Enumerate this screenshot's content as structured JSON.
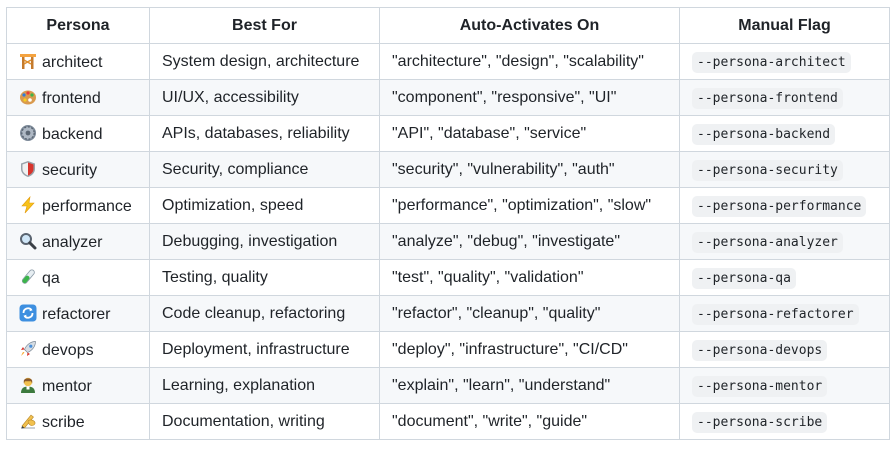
{
  "headers": [
    "Persona",
    "Best For",
    "Auto-Activates On",
    "Manual Flag"
  ],
  "rows": [
    {
      "icon": "building-construction-icon",
      "persona": "architect",
      "best_for": "System design, architecture",
      "triggers": "\"architecture\", \"design\", \"scalability\"",
      "flag": "--persona-architect"
    },
    {
      "icon": "artist-palette-icon",
      "persona": "frontend",
      "best_for": "UI/UX, accessibility",
      "triggers": "\"component\", \"responsive\", \"UI\"",
      "flag": "--persona-frontend"
    },
    {
      "icon": "gear-icon",
      "persona": "backend",
      "best_for": "APIs, databases, reliability",
      "triggers": "\"API\", \"database\", \"service\"",
      "flag": "--persona-backend"
    },
    {
      "icon": "shield-icon",
      "persona": "security",
      "best_for": "Security, compliance",
      "triggers": "\"security\", \"vulnerability\", \"auth\"",
      "flag": "--persona-security"
    },
    {
      "icon": "lightning-icon",
      "persona": "performance",
      "best_for": "Optimization, speed",
      "triggers": "\"performance\", \"optimization\", \"slow\"",
      "flag": "--persona-performance"
    },
    {
      "icon": "magnifying-glass-icon",
      "persona": "analyzer",
      "best_for": "Debugging, investigation",
      "triggers": "\"analyze\", \"debug\", \"investigate\"",
      "flag": "--persona-analyzer"
    },
    {
      "icon": "test-tube-icon",
      "persona": "qa",
      "best_for": "Testing, quality",
      "triggers": "\"test\", \"quality\", \"validation\"",
      "flag": "--persona-qa"
    },
    {
      "icon": "refresh-arrows-icon",
      "persona": "refactorer",
      "best_for": "Code cleanup, refactoring",
      "triggers": "\"refactor\", \"cleanup\", \"quality\"",
      "flag": "--persona-refactorer"
    },
    {
      "icon": "rocket-icon",
      "persona": "devops",
      "best_for": "Deployment, infrastructure",
      "triggers": "\"deploy\", \"infrastructure\", \"CI/CD\"",
      "flag": "--persona-devops"
    },
    {
      "icon": "teacher-icon",
      "persona": "mentor",
      "best_for": "Learning, explanation",
      "triggers": "\"explain\", \"learn\", \"understand\"",
      "flag": "--persona-mentor"
    },
    {
      "icon": "writing-hand-icon",
      "persona": "scribe",
      "best_for": "Documentation, writing",
      "triggers": "\"document\", \"write\", \"guide\"",
      "flag": "--persona-scribe"
    }
  ]
}
